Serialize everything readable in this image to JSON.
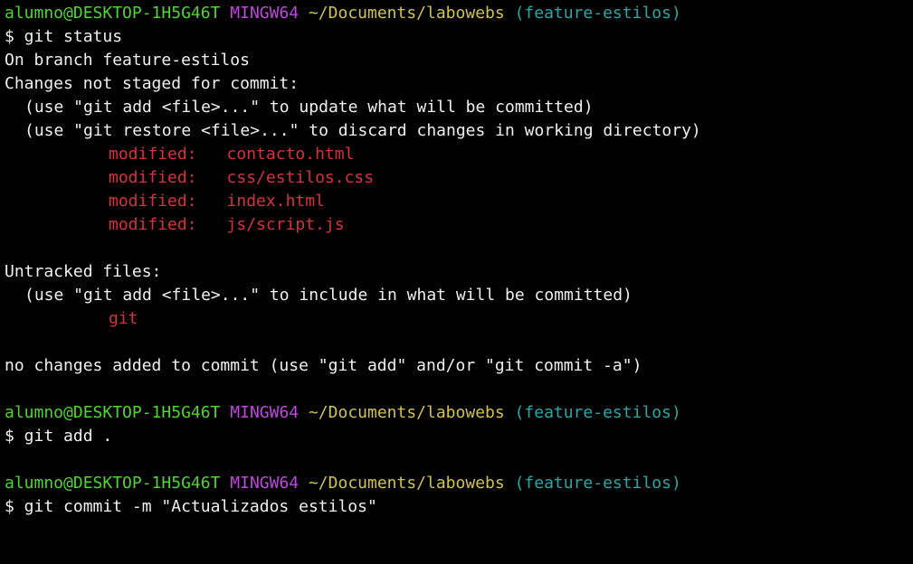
{
  "prompt1": {
    "user": "alumno@DESKTOP-1H5G46T",
    "system": "MINGW64",
    "path": "~/Documents/labowebs",
    "branch": "(feature-estilos)",
    "command": "$ git status"
  },
  "status": {
    "on_branch": "On branch feature-estilos",
    "changes_header": "Changes not staged for commit:",
    "hint_add": "(use \"git add <file>...\" to update what will be committed)",
    "hint_restore": "(use \"git restore <file>...\" to discard changes in working directory)",
    "modified": [
      {
        "label": "modified:",
        "file": "contacto.html"
      },
      {
        "label": "modified:",
        "file": "css/estilos.css"
      },
      {
        "label": "modified:",
        "file": "index.html"
      },
      {
        "label": "modified:",
        "file": "js/script.js"
      }
    ],
    "untracked_header": "Untracked files:",
    "hint_untracked": "(use \"git add <file>...\" to include in what will be committed)",
    "untracked": [
      "git"
    ],
    "summary": "no changes added to commit (use \"git add\" and/or \"git commit -a\")"
  },
  "prompt2": {
    "user": "alumno@DESKTOP-1H5G46T",
    "system": "MINGW64",
    "path": "~/Documents/labowebs",
    "branch": "(feature-estilos)",
    "command": "$ git add ."
  },
  "prompt3": {
    "user": "alumno@DESKTOP-1H5G46T",
    "system": "MINGW64",
    "path": "~/Documents/labowebs",
    "branch": "(feature-estilos)",
    "command": "$ git commit -m \"Actualizados estilos\""
  },
  "colors": {
    "background": "#000000",
    "user": "#4fd52e",
    "system": "#c147de",
    "path": "#d2c34a",
    "branch": "#2aa7a7",
    "text": "#f0f0f0",
    "modified": "#d8313a"
  }
}
